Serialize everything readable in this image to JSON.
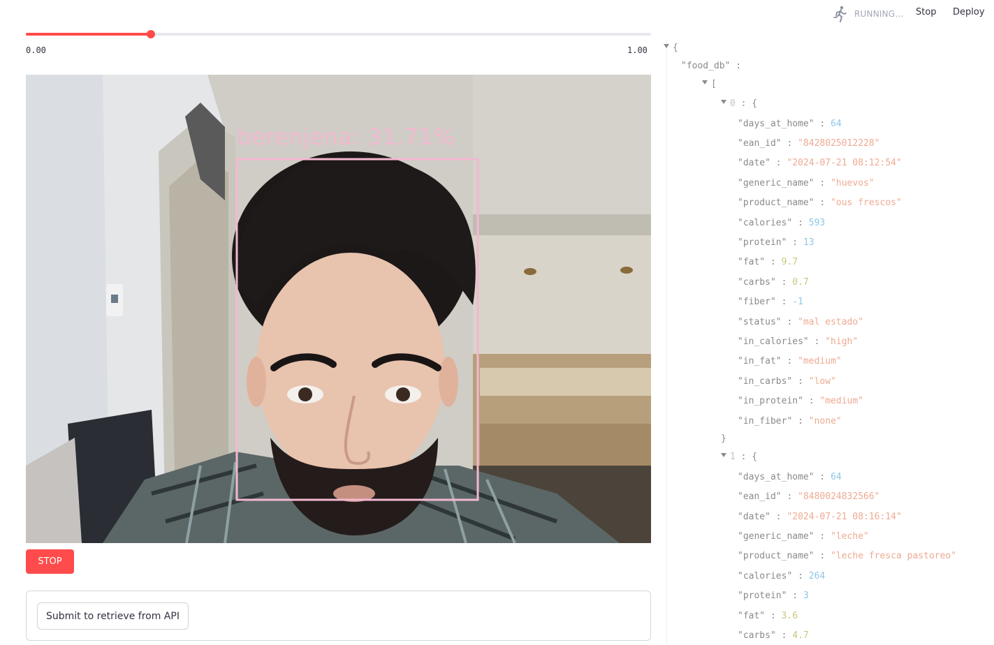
{
  "header": {
    "status": "RUNNING...",
    "stop_label": "Stop",
    "deploy_label": "Deploy",
    "running_icon": "running-person-icon"
  },
  "slider": {
    "min_label": "0.00",
    "max_label": "1.00",
    "value": 0.2,
    "accent_color": "#ff4b4b"
  },
  "video": {
    "detection_label": "berenjena: 31.71%",
    "box_color": "#f2b8d0"
  },
  "stop_button": {
    "label": "STOP",
    "color": "#ff4b4b"
  },
  "form": {
    "submit_label": "Submit to retrieve from API"
  },
  "json_view": {
    "root_key": "\"food_db\"",
    "items": [
      {
        "index": "0",
        "fields": [
          {
            "key": "\"days_at_home\"",
            "value": "64",
            "type": "int"
          },
          {
            "key": "\"ean_id\"",
            "value": "\"8428025012228\"",
            "type": "str"
          },
          {
            "key": "\"date\"",
            "value": "\"2024-07-21 08:12:54\"",
            "type": "str"
          },
          {
            "key": "\"generic_name\"",
            "value": "\"huevos\"",
            "type": "str"
          },
          {
            "key": "\"product_name\"",
            "value": "\"ous frescos\"",
            "type": "str"
          },
          {
            "key": "\"calories\"",
            "value": "593",
            "type": "int"
          },
          {
            "key": "\"protein\"",
            "value": "13",
            "type": "int"
          },
          {
            "key": "\"fat\"",
            "value": "9.7",
            "type": "float"
          },
          {
            "key": "\"carbs\"",
            "value": "0.7",
            "type": "float"
          },
          {
            "key": "\"fiber\"",
            "value": "-1",
            "type": "int"
          },
          {
            "key": "\"status\"",
            "value": "\"mal estado\"",
            "type": "str"
          },
          {
            "key": "\"in_calories\"",
            "value": "\"high\"",
            "type": "str"
          },
          {
            "key": "\"in_fat\"",
            "value": "\"medium\"",
            "type": "str"
          },
          {
            "key": "\"in_carbs\"",
            "value": "\"low\"",
            "type": "str"
          },
          {
            "key": "\"in_protein\"",
            "value": "\"medium\"",
            "type": "str"
          },
          {
            "key": "\"in_fiber\"",
            "value": "\"none\"",
            "type": "str"
          }
        ]
      },
      {
        "index": "1",
        "fields": [
          {
            "key": "\"days_at_home\"",
            "value": "64",
            "type": "int"
          },
          {
            "key": "\"ean_id\"",
            "value": "\"8480024832566\"",
            "type": "str"
          },
          {
            "key": "\"date\"",
            "value": "\"2024-07-21 08:16:14\"",
            "type": "str"
          },
          {
            "key": "\"generic_name\"",
            "value": "\"leche\"",
            "type": "str"
          },
          {
            "key": "\"product_name\"",
            "value": "\"leche fresca pastoreo\"",
            "type": "str"
          },
          {
            "key": "\"calories\"",
            "value": "264",
            "type": "int"
          },
          {
            "key": "\"protein\"",
            "value": "3",
            "type": "int"
          },
          {
            "key": "\"fat\"",
            "value": "3.6",
            "type": "float"
          },
          {
            "key": "\"carbs\"",
            "value": "4.7",
            "type": "float"
          }
        ]
      }
    ]
  }
}
